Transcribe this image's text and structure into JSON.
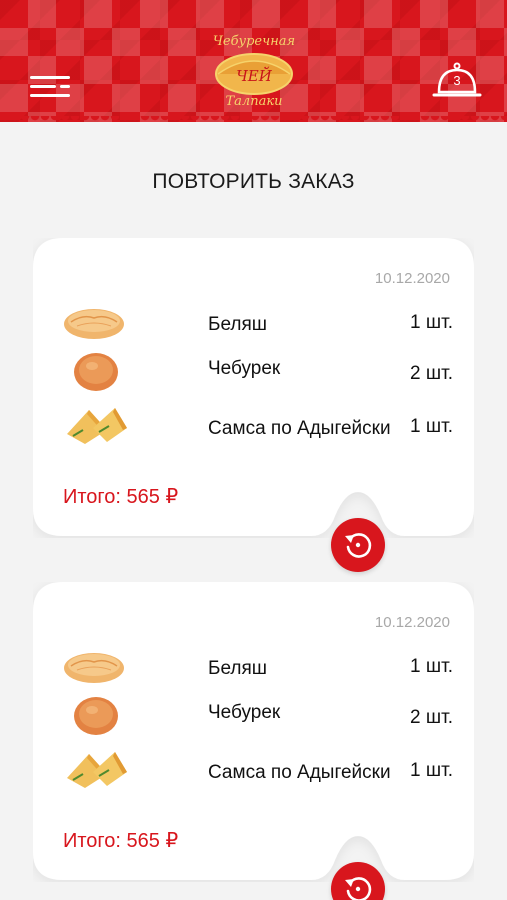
{
  "header": {
    "logo_top": "Чебуречная",
    "logo_middle": "ЧЕЙ",
    "logo_bottom": "Талпаки",
    "cart_count": "3",
    "brand_color": "#d8161d"
  },
  "page": {
    "title": "ПОВТОРИТЬ ЗАКАЗ"
  },
  "orders": [
    {
      "date": "10.12.2020",
      "items": [
        {
          "name": "Беляш",
          "qty": "1 шт.",
          "icon": "belyash-image"
        },
        {
          "name": "Чебурек",
          "qty": "2 шт.",
          "icon": "cheburek-image"
        },
        {
          "name": "Самса по Адыгейски",
          "qty": "1 шт.",
          "icon": "samsa-image"
        }
      ],
      "total": "Итого: 565 ₽"
    },
    {
      "date": "10.12.2020",
      "items": [
        {
          "name": "Беляш",
          "qty": "1 шт.",
          "icon": "belyash-image"
        },
        {
          "name": "Чебурек",
          "qty": "2 шт.",
          "icon": "cheburek-image"
        },
        {
          "name": "Самса по Адыгейски",
          "qty": "1 шт.",
          "icon": "samsa-image"
        }
      ],
      "total": "Итого: 565 ₽"
    }
  ]
}
